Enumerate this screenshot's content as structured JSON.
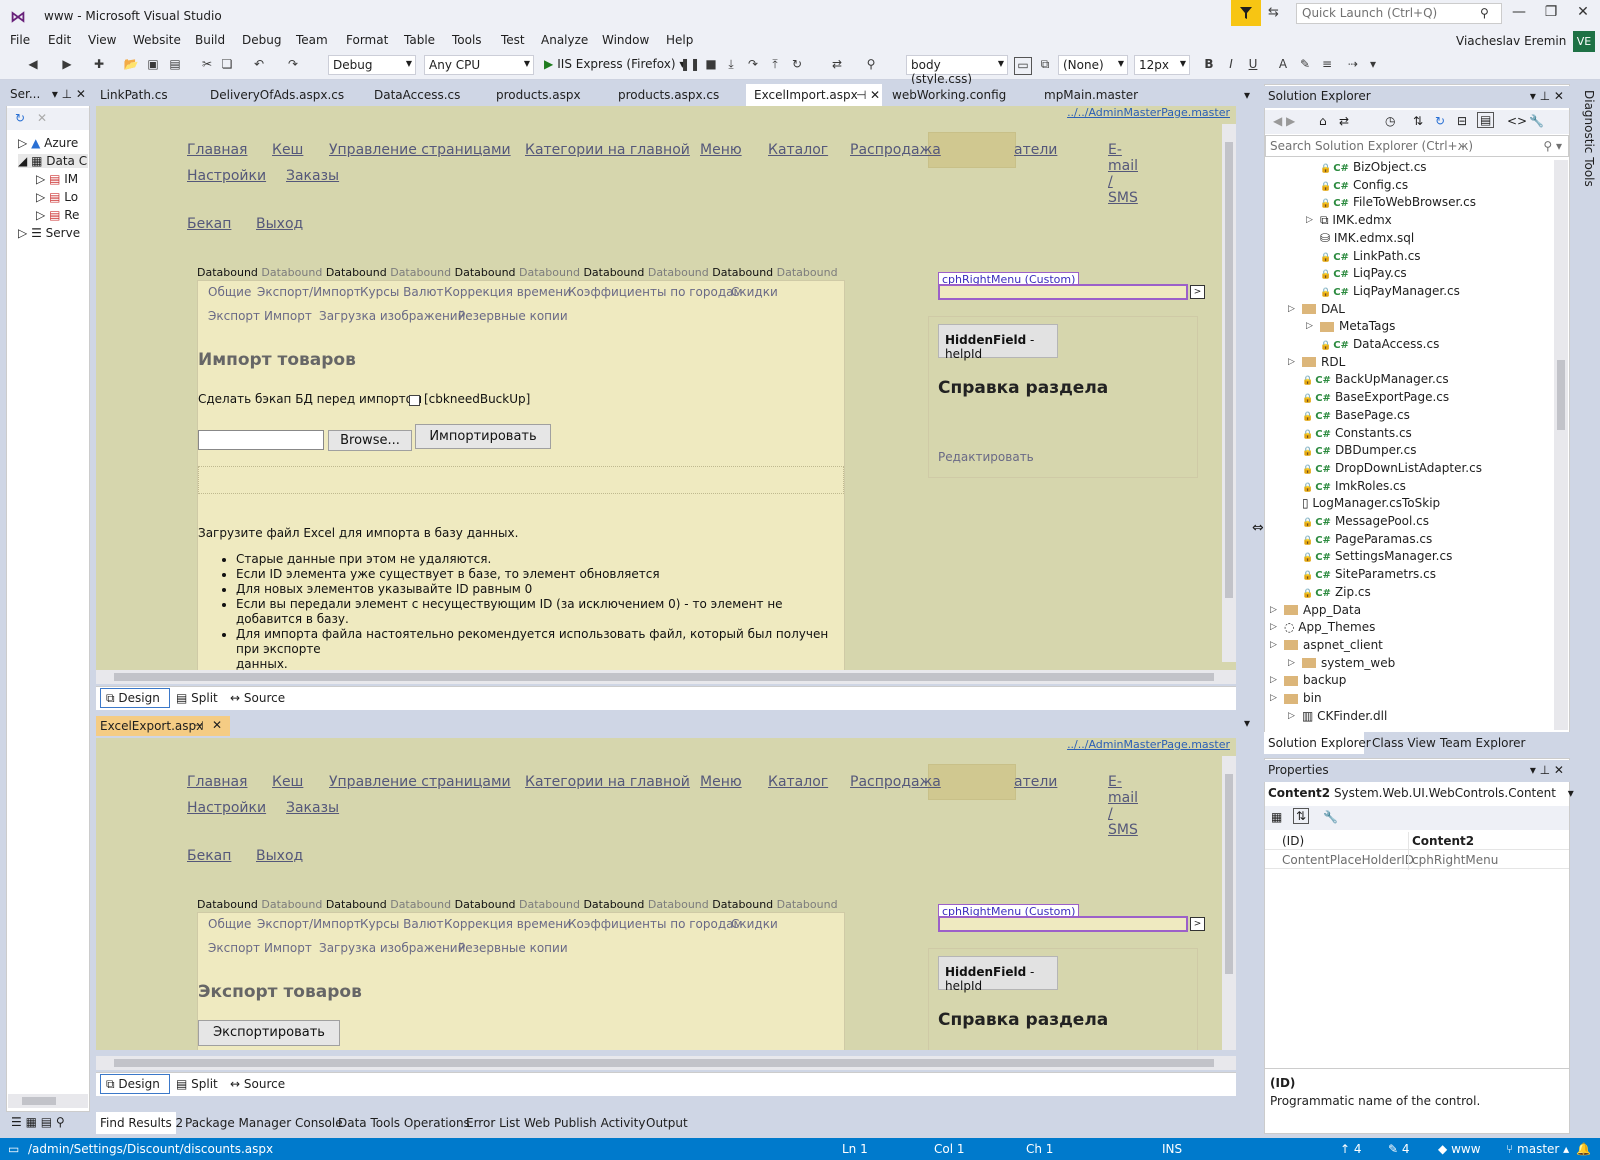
{
  "window": {
    "title": "www - Microsoft Visual Studio",
    "quick_launch_placeholder": "Quick Launch (Ctrl+Q)",
    "user_name": "Viacheslav Eremin",
    "user_initials": "VE"
  },
  "menu": [
    "File",
    "Edit",
    "View",
    "Website",
    "Build",
    "Debug",
    "Team",
    "Format",
    "Table",
    "Tools",
    "Test",
    "Analyze",
    "Window",
    "Help"
  ],
  "toolbar": {
    "config": "Debug",
    "platform": "Any CPU",
    "run_label": "IIS Express (Firefox)",
    "style_target": "body (style.css)",
    "font_name": "(None)",
    "font_size": "12px",
    "bold": "B",
    "italic": "I",
    "underline": "U"
  },
  "server_explorer": {
    "title": "Ser...",
    "items": [
      "Azure",
      "Data C",
      "IM",
      "Lo",
      "Re",
      "Serve"
    ]
  },
  "doc_tabs": [
    "LinkPath.cs",
    "DeliveryOfAds.aspx.cs",
    "DataAccess.cs",
    "products.aspx",
    "products.aspx.cs",
    "ExcelImport.aspx",
    "webWorking.config",
    "mpMain.master"
  ],
  "designer_top": {
    "master_link": "../../AdminMasterPage.master",
    "nav": [
      "Главная",
      "Кеш",
      "Управление страницами",
      "Категории на главной",
      "Меню",
      "Каталог",
      "Распродажа",
      "атели",
      "Настройки",
      "Заказы",
      "Бекап",
      "Выход"
    ],
    "nav_email_lines": [
      "E-",
      "mail",
      "/",
      "SMS"
    ],
    "databound_dark": "Databound",
    "databound_light": "Databound",
    "sub_nav_row1": [
      "Общие",
      "Экспорт/Импорт",
      "Курсы Валют",
      "Коррекция времени",
      "Коэффициенты по городам",
      "Скидки"
    ],
    "sub_nav_row2": [
      "Экспорт",
      "Импорт",
      "Загрузка изображений",
      "Резервные копии"
    ],
    "page_title": "Импорт товаров",
    "backup_label": "Сделать бэкап БД перед импортом",
    "backup_checkbox_label": "[cbkneedBuckUp]",
    "browse_button": "Browse...",
    "import_button": "Импортировать",
    "instructions_title": "Загрузите файл Excel для импорта в базу данных.",
    "instructions": [
      "Старые данные при этом не удаляются.",
      "Если ID элемента уже существует в базе, то элемент обновляется",
      "Для новых элементов указывайте ID равным 0",
      "Если вы передали элемент с несуществующим ID (за исключением 0) - то элемент не добавится в базу.",
      "Для импорта файла настоятельно рекомендуется использовать файл, который был получен при экспорте",
      "данных."
    ],
    "cph_label": "cphRightMenu (Custom)",
    "hidden_field_bold": "HiddenField",
    "hidden_field_rest": " - helpId",
    "help_title": "Справка раздела",
    "edit_link": "Редактировать"
  },
  "view_tabs": [
    "Design",
    "Split",
    "Source"
  ],
  "second_doc_tab": "ExcelExport.aspx",
  "designer_bottom": {
    "page_title": "Экспорт товаров",
    "export_button": "Экспортировать"
  },
  "solution_explorer": {
    "title": "Solution Explorer",
    "search_placeholder": "Search Solution Explorer (Ctrl+ж)",
    "rows": [
      {
        "label": "BizObject.cs",
        "kind": "cs",
        "level": 3
      },
      {
        "label": "Config.cs",
        "kind": "cs",
        "level": 3
      },
      {
        "label": "FileToWebBrowser.cs",
        "kind": "cs",
        "level": 3
      },
      {
        "label": "IMK.edmx",
        "kind": "edmx",
        "level": 3
      },
      {
        "label": "IMK.edmx.sql",
        "kind": "sql",
        "level": 3
      },
      {
        "label": "LinkPath.cs",
        "kind": "cs",
        "level": 3
      },
      {
        "label": "LiqPay.cs",
        "kind": "cs",
        "level": 3
      },
      {
        "label": "LiqPayManager.cs",
        "kind": "cs",
        "level": 3
      },
      {
        "label": "DAL",
        "kind": "folder",
        "level": 2
      },
      {
        "label": "MetaTags",
        "kind": "folder",
        "level": 3
      },
      {
        "label": "DataAccess.cs",
        "kind": "cs",
        "level": 3
      },
      {
        "label": "RDL",
        "kind": "folder",
        "level": 2
      },
      {
        "label": "BackUpManager.cs",
        "kind": "cs",
        "level": 2
      },
      {
        "label": "BaseExportPage.cs",
        "kind": "cs",
        "level": 2
      },
      {
        "label": "BasePage.cs",
        "kind": "cs",
        "level": 2
      },
      {
        "label": "Constants.cs",
        "kind": "cs",
        "level": 2
      },
      {
        "label": "DBDumper.cs",
        "kind": "cs",
        "level": 2
      },
      {
        "label": "DropDownListAdapter.cs",
        "kind": "cs",
        "level": 2
      },
      {
        "label": "ImkRoles.cs",
        "kind": "cs",
        "level": 2
      },
      {
        "label": "LogManager.csToSkip",
        "kind": "file",
        "level": 2
      },
      {
        "label": "MessagePool.cs",
        "kind": "cs",
        "level": 2
      },
      {
        "label": "PageParamas.cs",
        "kind": "cs",
        "level": 2
      },
      {
        "label": "SettingsManager.cs",
        "kind": "cs",
        "level": 2
      },
      {
        "label": "SiteParametrs.cs",
        "kind": "cs",
        "level": 2
      },
      {
        "label": "Zip.cs",
        "kind": "cs",
        "level": 2
      },
      {
        "label": "App_Data",
        "kind": "folder",
        "level": 1
      },
      {
        "label": "App_Themes",
        "kind": "themes",
        "level": 1
      },
      {
        "label": "aspnet_client",
        "kind": "folder",
        "level": 1
      },
      {
        "label": "system_web",
        "kind": "folder",
        "level": 2
      },
      {
        "label": "backup",
        "kind": "folder",
        "level": 1
      },
      {
        "label": "bin",
        "kind": "folder",
        "level": 1
      },
      {
        "label": "CKFinder.dll",
        "kind": "dll",
        "level": 2
      }
    ],
    "tabs": [
      "Solution Explorer",
      "Class View",
      "Team Explorer"
    ]
  },
  "properties": {
    "title": "Properties",
    "object_name": "Content2",
    "object_type": "System.Web.UI.WebControls.Content",
    "rows": [
      {
        "name": "(ID)",
        "value": "Content2"
      },
      {
        "name": "ContentPlaceHolderID",
        "value": "cphRightMenu"
      }
    ],
    "desc_title": "(ID)",
    "desc_text": "Programmatic name of the control."
  },
  "diagnostic_tools": "Diagnostic Tools",
  "bottom_tabs": [
    "Find Results 2",
    "Package Manager Console",
    "Data Tools Operations",
    "Error List",
    "Web Publish Activity",
    "Output"
  ],
  "status": {
    "path": "/admin/Settings/Discount/discounts.aspx",
    "ln": "Ln 1",
    "col": "Col 1",
    "ch": "Ch 1",
    "mode": "INS",
    "up_count": "4",
    "edit_count": "4",
    "repo": "www",
    "branch": "master"
  },
  "colors": {
    "accent": "#007acc",
    "designer_bg": "#d6d6ad",
    "content_bg": "#efeac0",
    "cph_border": "#9c60c9"
  }
}
